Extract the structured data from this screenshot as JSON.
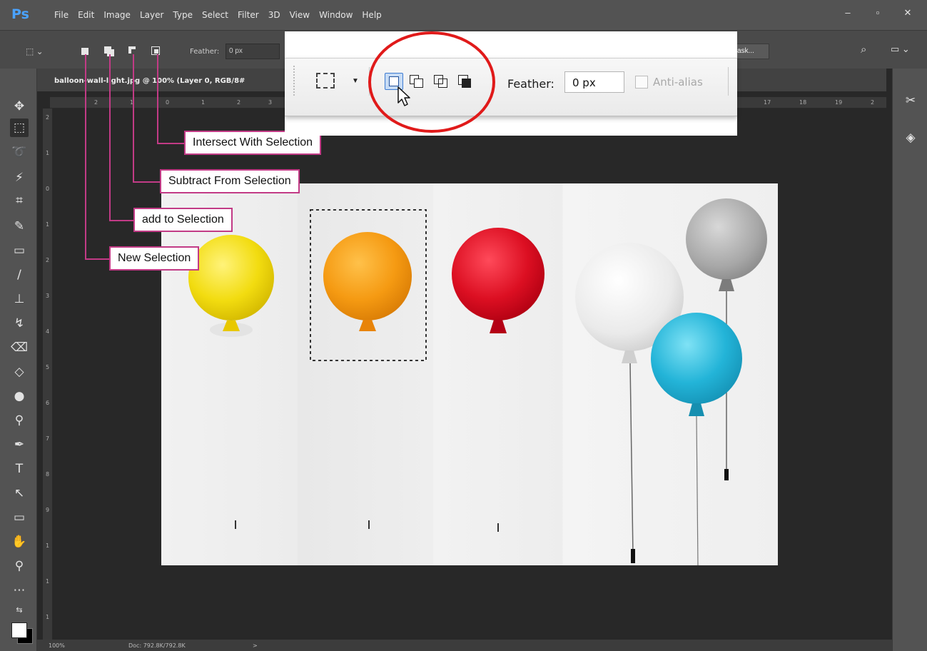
{
  "app": {
    "logo": "Ps"
  },
  "menu": [
    "File",
    "Edit",
    "Image",
    "Layer",
    "Type",
    "Select",
    "Filter",
    "3D",
    "View",
    "Window",
    "Help"
  ],
  "window_controls": {
    "minimize": "–",
    "maximize": "▫",
    "close": "✕"
  },
  "options_bar": {
    "marquee_icon": "⬚ ⌄",
    "feather_label": "Feather:",
    "feather_value": "0 px",
    "mask_button": "ask...",
    "search_icon": "⌕",
    "workspace_icon": "▭ ⌄"
  },
  "document": {
    "tab_title": "balloon-wall-light.jpg @ 100% (Layer 0, RGB/8#",
    "ruler_top": [
      "2",
      "1",
      "0",
      "1",
      "2",
      "3",
      "17",
      "18",
      "19",
      "2"
    ],
    "ruler_left": [
      "2",
      "1",
      "0",
      "1",
      "2",
      "3",
      "4",
      "5",
      "6",
      "7",
      "8",
      "9",
      "1",
      "1",
      "1"
    ]
  },
  "status": {
    "zoom": "100%",
    "doc": "Doc: 792.8K/792.8K",
    "arrow": ">"
  },
  "zoom_callout": {
    "feather_label": "Feather:",
    "feather_value": "0 px",
    "antialias_label": "Anti-alias"
  },
  "callouts": {
    "intersect": "Intersect With Selection",
    "subtract": "Subtract From Selection",
    "add": "add to Selection",
    "new": "New Selection"
  },
  "colors": {
    "accent": "#c23b86",
    "highlight_ring": "#e01a1a",
    "ps_blue": "#4aa3ff"
  }
}
